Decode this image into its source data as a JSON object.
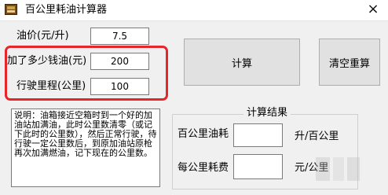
{
  "window": {
    "title": "百公里耗油计算器",
    "close_glyph": "×"
  },
  "inputs": {
    "fuel_price_label": "油价(元/升)",
    "fuel_price_value": "7.5",
    "fuel_amount_label": "加了多少钱油(元)",
    "fuel_amount_value": "200",
    "distance_label": "行驶里程(公里)",
    "distance_value": "100"
  },
  "buttons": {
    "calculate": "计算",
    "reset": "清空重算"
  },
  "instructions": {
    "text": "说明：油箱接近空箱时到一个好的加油站加满油，此时公里数清零（或记下此时的公里数），然后正常行驶，待行驶一定公里数后，到原加油站原枪再次加满燃油，记下现在的公里数。"
  },
  "results": {
    "group_title": "计算结果",
    "consumption_label": "百公里油耗",
    "consumption_unit": "升/百公里",
    "consumption_value": "",
    "cost_label": "每公里耗费",
    "cost_unit": "元/公里",
    "cost_value": ""
  },
  "colors": {
    "highlight": "#e8262a",
    "window_bg": "#f0f0f0"
  },
  "icons": {
    "app": "calculator-app-icon",
    "close": "close-icon"
  }
}
